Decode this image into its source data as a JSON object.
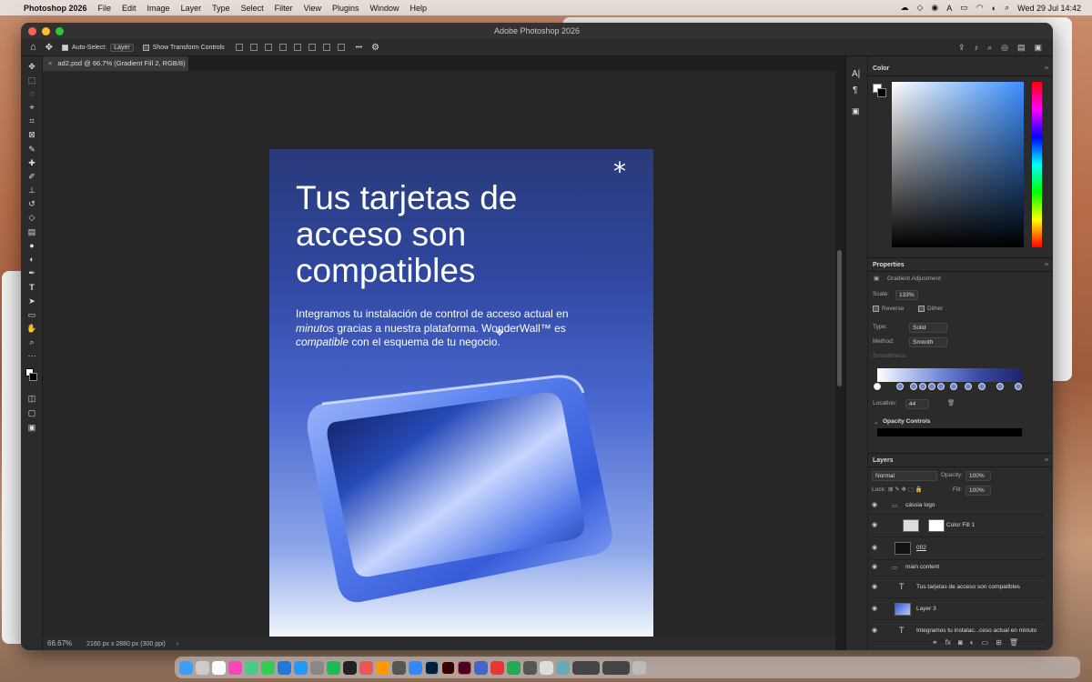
{
  "menubar": {
    "app_name": "Photoshop 2026",
    "items": [
      "File",
      "Edit",
      "Image",
      "Layer",
      "Type",
      "Select",
      "Filter",
      "View",
      "Plugins",
      "Window",
      "Help"
    ],
    "clock": "Wed 29 Jul  14:42"
  },
  "window": {
    "title": "Adobe Photoshop 2026"
  },
  "options_bar": {
    "auto_select_label": "Auto-Select:",
    "auto_select_value": "Layer",
    "transform_label": "Show Transform Controls",
    "more_label": "•••"
  },
  "document": {
    "tab_label": "ad2.psd @ 66.7% (Gradient Fill 2, RGB/8) *",
    "close_glyph": "×",
    "zoom": "66.67%",
    "dimensions": "2160 px x 2880 px (300 ppi)",
    "heading": "Tus tarjetas de acceso son compatibles",
    "body_parts": [
      "Integramos tu instalación de control de acceso actual en ",
      "minutos",
      " gracias a nuestra plataforma. WonderWall™ es ",
      "compatible",
      " con el esquema de tu negocio."
    ],
    "asterisk": "*"
  },
  "color_panel": {
    "title": "Color"
  },
  "properties": {
    "title": "Properties",
    "subtitle": "Gradient Adjustment",
    "scale_label": "Scale:",
    "scale_value": "133%",
    "reverse_label": "Reverse",
    "dither_label": "Dither",
    "type_label": "Type:",
    "type_value": "Solid",
    "method_label": "Method:",
    "method_value": "Smooth",
    "smoothness_label": "Smoothness:",
    "location_label": "Location:",
    "location_value": "44",
    "opacity_controls_label": "Opacity Controls"
  },
  "layers": {
    "title": "Layers",
    "blend_mode": "Normal",
    "opacity_label": "Opacity:",
    "opacity_value": "100%",
    "lock_label": "Lock:",
    "fill_label": "Fill:",
    "fill_value": "100%",
    "items": [
      {
        "name": "cássia logo",
        "kind": "group"
      },
      {
        "name": "Color Fill 1",
        "kind": "fill"
      },
      {
        "name": "002",
        "kind": "smart"
      },
      {
        "name": "main content",
        "kind": "group"
      },
      {
        "name": "Tus tarjetas de acceso son compatibles",
        "kind": "text"
      },
      {
        "name": "Layer 3",
        "kind": "pixel"
      },
      {
        "name": "Integramos tu instalac...ceso actual en minuto",
        "kind": "text"
      }
    ]
  },
  "colors": {
    "accent": "#4a68d0",
    "panel": "#2b2b2b",
    "canvas": "#262626"
  }
}
